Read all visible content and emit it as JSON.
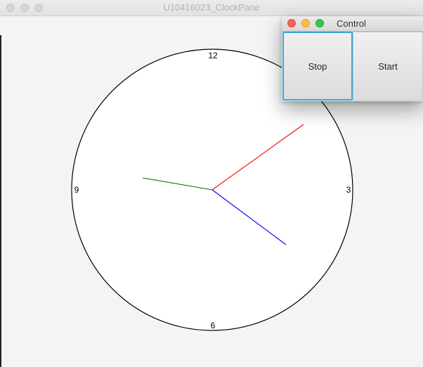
{
  "main_window": {
    "title": "U10416023_ClockPane"
  },
  "clock": {
    "numbers": {
      "twelve": "12",
      "three": "3",
      "six": "6",
      "nine": "9"
    },
    "hands": {
      "second_color": "#ff0000",
      "minute_color": "#0000ff",
      "hour_color": "#008000"
    }
  },
  "control_window": {
    "title": "Control",
    "stop_label": "Stop",
    "start_label": "Start"
  }
}
